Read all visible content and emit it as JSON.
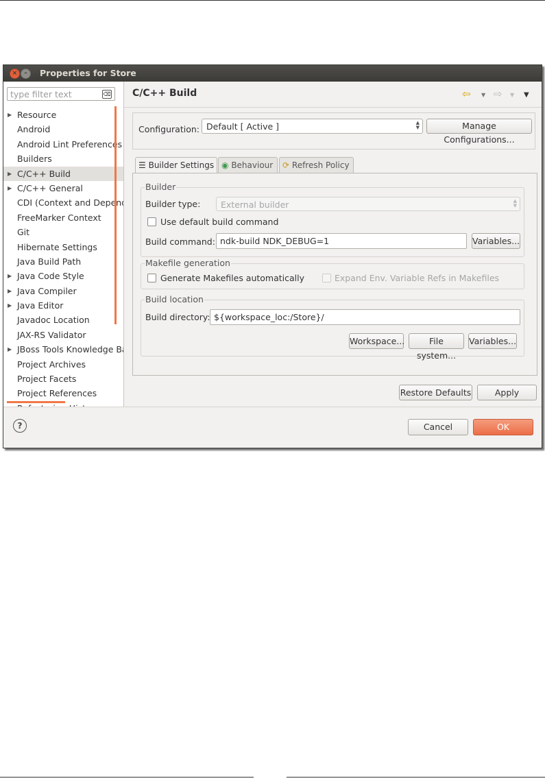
{
  "window": {
    "title": "Properties for Store",
    "close_glyph": "×",
    "min_glyph": "–"
  },
  "sidebar": {
    "filter_placeholder": "type filter text",
    "filter_clear_glyph": "⌫",
    "items": [
      {
        "label": "Resource",
        "expandable": true
      },
      {
        "label": "Android",
        "expandable": false
      },
      {
        "label": "Android Lint Preferences",
        "expandable": false
      },
      {
        "label": "Builders",
        "expandable": false
      },
      {
        "label": "C/C++ Build",
        "expandable": true,
        "selected": true
      },
      {
        "label": "C/C++ General",
        "expandable": true
      },
      {
        "label": "CDI (Context and Dependency Injection)",
        "expandable": false
      },
      {
        "label": "FreeMarker Context",
        "expandable": false
      },
      {
        "label": "Git",
        "expandable": false
      },
      {
        "label": "Hibernate Settings",
        "expandable": false
      },
      {
        "label": "Java Build Path",
        "expandable": false
      },
      {
        "label": "Java Code Style",
        "expandable": true
      },
      {
        "label": "Java Compiler",
        "expandable": true
      },
      {
        "label": "Java Editor",
        "expandable": true
      },
      {
        "label": "Javadoc Location",
        "expandable": false
      },
      {
        "label": "JAX-RS Validator",
        "expandable": false
      },
      {
        "label": "JBoss Tools Knowledge Base",
        "expandable": true
      },
      {
        "label": "Project Archives",
        "expandable": false
      },
      {
        "label": "Project Facets",
        "expandable": false
      },
      {
        "label": "Project References",
        "expandable": false
      },
      {
        "label": "Refactoring History",
        "expandable": false
      }
    ]
  },
  "main": {
    "title": "C/C++ Build",
    "nav": {
      "back": "⇦",
      "forward": "⇨",
      "dropdown": "▼",
      "menu": "▼"
    },
    "configuration": {
      "label": "Configuration:",
      "value": "Default  [ Active ]",
      "manage_button": "Manage Configurations..."
    },
    "tabs": [
      {
        "label": "Builder Settings",
        "icon": "list-icon",
        "glyph": "☰",
        "active": true
      },
      {
        "label": "Behaviour",
        "icon": "radio-icon",
        "glyph": "◉",
        "active": false
      },
      {
        "label": "Refresh Policy",
        "icon": "refresh-icon",
        "glyph": "⟳",
        "active": false
      }
    ],
    "builder": {
      "group_title": "Builder",
      "type_label": "Builder type:",
      "type_value": "External builder",
      "use_default_label": "Use default build command",
      "use_default_checked": false,
      "command_label": "Build command:",
      "command_value": "ndk-build NDK_DEBUG=1",
      "variables_button": "Variables..."
    },
    "makefile": {
      "group_title": "Makefile generation",
      "generate_label": "Generate Makefiles automatically",
      "generate_checked": false,
      "expand_label": "Expand Env. Variable Refs in Makefiles",
      "expand_checked": false
    },
    "location": {
      "group_title": "Build location",
      "dir_label": "Build directory:",
      "dir_value": "${workspace_loc:/Store}/",
      "workspace_button": "Workspace...",
      "filesystem_button": "File system...",
      "variables_button": "Variables..."
    },
    "restore_defaults_button": "Restore Defaults",
    "apply_button": "Apply"
  },
  "footer": {
    "help_glyph": "?",
    "cancel_button": "Cancel",
    "ok_button": "OK"
  },
  "colors": {
    "accent": "#f07746",
    "ok_button": "#eb6e48",
    "titlebar": "#3c3b37",
    "selected_row": "#e2e0dd"
  }
}
